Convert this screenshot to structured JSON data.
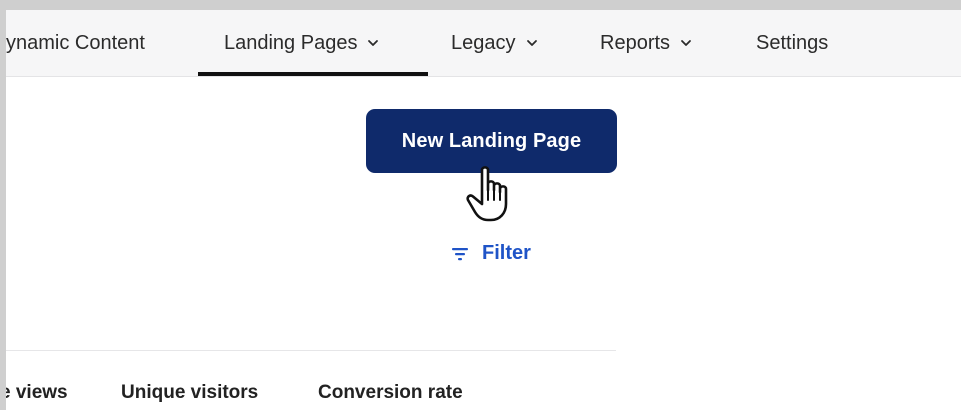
{
  "nav": {
    "items": [
      {
        "label": "ynamic Content",
        "has_dropdown": false
      },
      {
        "label": "Landing Pages",
        "has_dropdown": true,
        "active": true
      },
      {
        "label": "Legacy",
        "has_dropdown": true
      },
      {
        "label": "Reports",
        "has_dropdown": true
      },
      {
        "label": "Settings",
        "has_dropdown": false
      }
    ]
  },
  "toolbar": {
    "new_button_label": "New Landing Page",
    "filter_label": "Filter"
  },
  "table": {
    "columns": [
      "e views",
      "Unique visitors",
      "Conversion rate"
    ]
  },
  "icons": {
    "chevron": "chevron-down-icon",
    "filter": "filter-lines-icon",
    "cursor": "hand-pointer-icon"
  },
  "colors": {
    "primary_button": "#0f2a6b",
    "link_blue": "#1f54c7",
    "nav_background": "#f6f6f7",
    "active_underline": "#111111"
  }
}
